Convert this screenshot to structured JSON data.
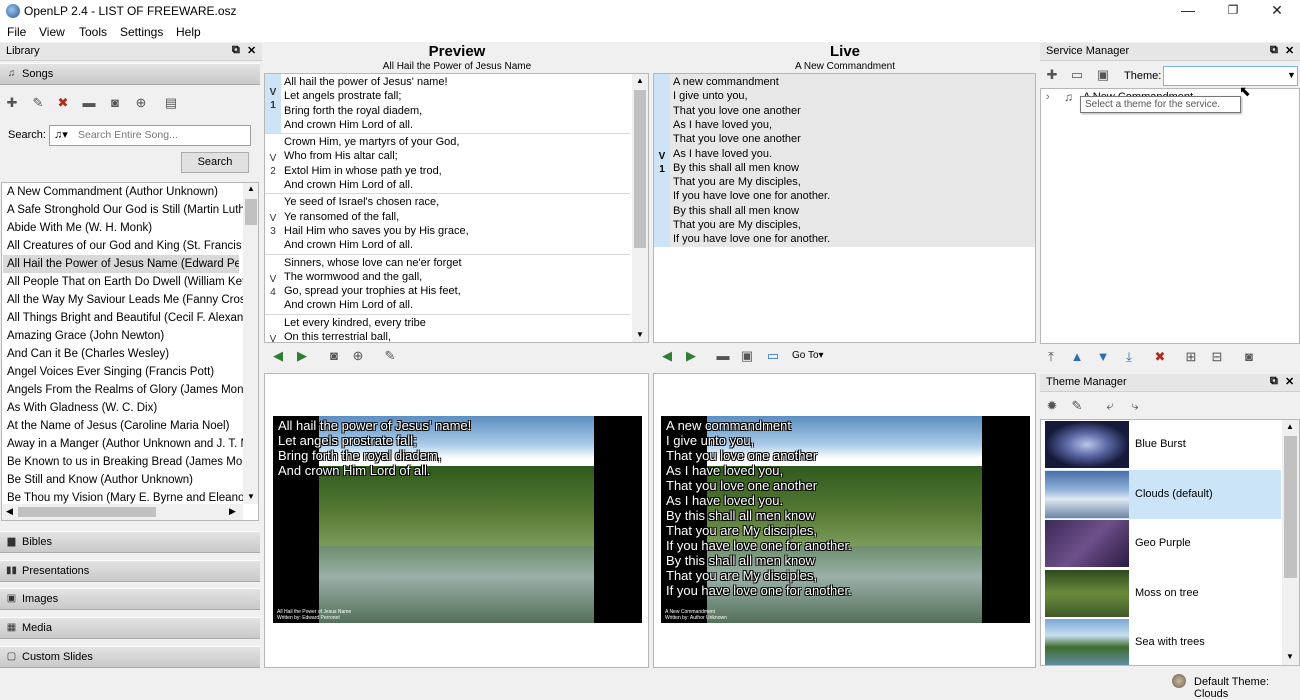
{
  "window": {
    "title": "OpenLP 2.4 - LIST OF FREEWARE.osz",
    "minimize": "—",
    "maximize": "❐",
    "close": "✕"
  },
  "menu": [
    "File",
    "View",
    "Tools",
    "Settings",
    "Help"
  ],
  "library": {
    "title": "Library",
    "songs_label": "Songs",
    "search_label": "Search:",
    "search_placeholder": "Search Entire Song...",
    "search_button": "Search",
    "songs": [
      "A New Commandment (Author Unknown)",
      "A Safe Stronghold Our God is Still (Martin Luthe",
      "Abide With Me (W. H. Monk)",
      "All Creatures of our God and King (St. Francis of",
      "All Hail the Power of Jesus Name (Edward Perro",
      "All People That on Earth Do Dwell (William Keth",
      "All the Way My Saviour Leads Me (Fanny Crosby",
      "All Things Bright and Beautiful (Cecil F. Alexanc",
      "Amazing Grace (John Newton)",
      "And Can it Be (Charles Wesley)",
      "Angel Voices Ever Singing (Francis Pott)",
      "Angels From the Realms of Glory (James Montg",
      "As With Gladness (W. C. Dix)",
      "At the Name of Jesus (Caroline Maria Noel)",
      "Away in a Manger (Author Unknown and J. T. M",
      "Be Known to us in Breaking Bread (James Mont",
      "Be Still and Know (Author Unknown)",
      "Be Thou my Vision (Mary E. Byrne and Eleanor I"
    ],
    "selected_index": 4,
    "categories": [
      "Bibles",
      "Presentations",
      "Images",
      "Media",
      "Custom Slides"
    ]
  },
  "preview": {
    "heading": "Preview",
    "subheading": "All Hail the Power of Jesus Name",
    "verses": [
      {
        "tag": "V\n1",
        "lines": [
          "All hail the power of Jesus' name!",
          "Let angels prostrate fall;",
          "Bring forth the royal diadem,",
          "And crown Him Lord of all."
        ]
      },
      {
        "tag": "V\n2",
        "lines": [
          "Crown Him, ye martyrs of your God,",
          "Who from His altar call;",
          "Extol Him in whose path ye trod,",
          "And crown Him Lord of all."
        ]
      },
      {
        "tag": "V\n3",
        "lines": [
          "Ye seed of Israel's chosen race,",
          "Ye ransomed of the fall,",
          "Hail Him who saves you by His grace,",
          "And crown Him Lord of all."
        ]
      },
      {
        "tag": "V\n4",
        "lines": [
          "Sinners, whose love can ne'er forget",
          "The wormwood and the gall,",
          "Go, spread your trophies at His feet,",
          "And crown Him Lord of all."
        ]
      },
      {
        "tag": "V",
        "lines": [
          "Let every kindred, every tribe",
          "On this terrestrial ball,"
        ]
      }
    ],
    "screen_text": [
      "All hail the power of Jesus' name!",
      "Let angels prostrate fall;",
      "Bring forth the royal diadem,",
      "And crown Him Lord of all."
    ],
    "screen_footer": [
      "All Hail the Power of Jesus Name",
      "Written by: Edward Perronet"
    ]
  },
  "live": {
    "heading": "Live",
    "subheading": "A New Commandment",
    "tag": "V\n1",
    "lines": [
      "A new commandment",
      "I give unto you,",
      "That you love one another",
      "As I have loved you,",
      "That you love one another",
      "As I have loved you.",
      "By this shall all men know",
      "That you are My disciples,",
      "If you have love one for another.",
      "By this shall all men know",
      "That you are My disciples,",
      "If you have love one for another."
    ],
    "goto": "Go To",
    "screen_footer": [
      "A New Commandment",
      "Written by: Author Unknown"
    ]
  },
  "service": {
    "title": "Service Manager",
    "theme_label": "Theme:",
    "theme_value": "",
    "tooltip": "Select a theme for the service.",
    "item": "A New Commandment"
  },
  "themes": {
    "title": "Theme Manager",
    "items": [
      "Blue Burst",
      "Clouds (default)",
      "Geo Purple",
      "Moss on tree",
      "Sea with trees"
    ],
    "selected_index": 1
  },
  "status": {
    "default_theme": "Default Theme: Clouds"
  }
}
